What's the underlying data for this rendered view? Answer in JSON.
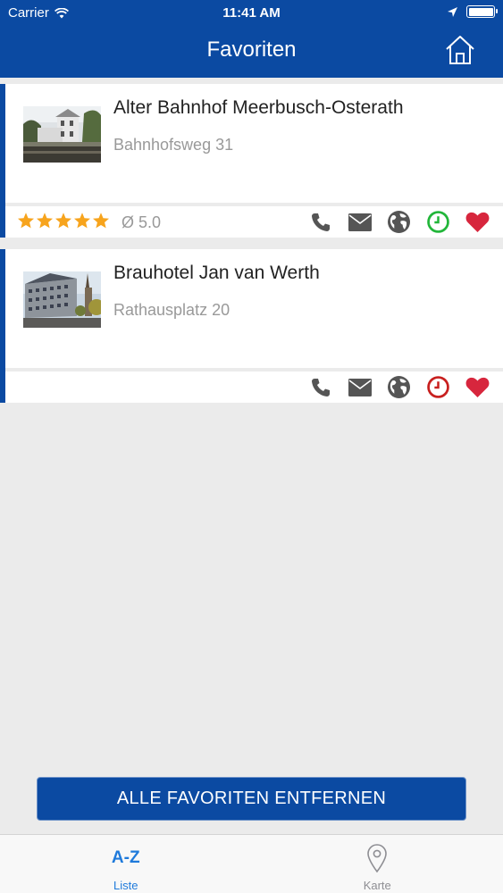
{
  "status_bar": {
    "carrier": "Carrier",
    "time": "11:41 AM"
  },
  "header": {
    "title": "Favoriten",
    "home_icon": "home-icon"
  },
  "favorites": [
    {
      "name": "Alter Bahnhof Meerbusch-Osterath",
      "address": "Bahnhofsweg 31",
      "stars": 5,
      "rating": "Ø 5.0",
      "clock_color": "#22b63a"
    },
    {
      "name": "Brauhotel Jan van Werth",
      "address": "Rathausplatz 20",
      "clock_color": "#c8201f"
    }
  ],
  "actions": [
    "phone-icon",
    "mail-icon",
    "globe-icon",
    "clock-icon",
    "heart-icon"
  ],
  "remove_button": "ALLE FAVORITEN ENTFERNEN",
  "tabbar": [
    {
      "icon": "A-Z",
      "label": "Liste",
      "active": true
    },
    {
      "icon": "map-pin-icon",
      "label": "Karte",
      "active": false
    }
  ],
  "colors": {
    "brand": "#0b4aa2",
    "heart": "#d7263d",
    "star": "#f7a41d",
    "icon_gray": "#555555"
  }
}
